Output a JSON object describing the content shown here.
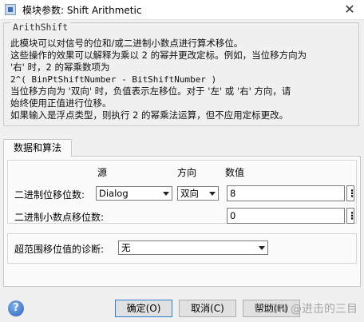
{
  "window": {
    "title": "模块参数: Shift Arithmetic",
    "close_glyph": "✕"
  },
  "description": {
    "block_name": "ArithShift",
    "line1": "此模块可以对信号的位和/或二进制小数点进行算术移位。",
    "line2": "这些操作的效果可以解释为乘以 2 的幂并更改定标。例如，当位移方向为",
    "line3": "'右' 时，2 的幂乘数项为",
    "line4": "2^( BinPtShiftNumber - BitShiftNumber )",
    "line5": "当位移方向为 '双向' 时，负值表示左移位。对于 '左' 或 '右' 方向，请",
    "line6": "始终使用正值进行位移。",
    "line7": "如果输入是浮点类型，则执行 2 的幂乘法运算，但不应用定标更改。"
  },
  "tabs": [
    {
      "label": "数据和算法",
      "selected": true
    }
  ],
  "params": {
    "col_source": "源",
    "col_direction": "方向",
    "col_value": "数值",
    "bit_shift": {
      "label": "二进制位移位数:",
      "source": "Dialog",
      "direction": "双向",
      "value": "8"
    },
    "binpt_shift": {
      "label": "二进制小数点移位数:",
      "value": "0"
    },
    "kebab_glyph": "⋮"
  },
  "diagnostics": {
    "label": "超范围移位值的诊断:",
    "value": "无"
  },
  "buttons": {
    "ok": "确定(O)",
    "cancel": "取消(C)",
    "help": "帮助(H)"
  },
  "help_glyph": "?",
  "watermark": "CSDN @进击的三目"
}
